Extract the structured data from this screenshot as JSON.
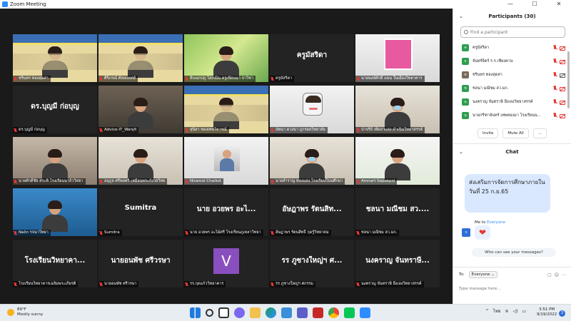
{
  "window": {
    "title": "Zoom Meeting",
    "controls": [
      "—",
      "☐",
      "✕"
    ]
  },
  "tiles": [
    {
      "label": "ชรินทร ทองสุดสา",
      "visual": "banner-person"
    },
    {
      "label": "ศิริภรณ์ ศัลยแพทย์",
      "visual": "banner-person"
    },
    {
      "label": "สิบเอกปภู โสภณิน ครูเขียนนา จาวิชา",
      "visual": "green-person"
    },
    {
      "label": "ครูมัสริดา",
      "display": "ครูมัสริดา"
    },
    {
      "label": "นายพงษ์ศักดิ์ แพน ในเมืองวิทยาคาร",
      "visual": "pink-frame"
    },
    {
      "label": "ดร.บุญมี ก่อบุญ",
      "display": "ดร.บุญมี ก่อบุญ"
    },
    {
      "label": "Advice-IT_Wanjit",
      "visual": "office-person"
    },
    {
      "label": "สุนิสา ทองเทพวิจารณ์",
      "visual": "banner-person"
    },
    {
      "label": "ปพนา ดวงนา ภูกรผลวิทยาลัย",
      "visual": "cartoon"
    },
    {
      "label": "ปาจรีย์ เพียลาแสง ดำเนินวิทยาสรรค์",
      "visual": "mask-person"
    },
    {
      "label": "นายศักดิ์ชัย สระทิ โรงเรียนนาถ้ววิทยา",
      "visual": "room-person"
    },
    {
      "label": "อนุกูล ศรีพลตรี เหมือนพระกังวลวิทย",
      "visual": "wall-person"
    },
    {
      "label": "Niramol Chaikot",
      "visual": "photo"
    },
    {
      "label": "นายสำราญ ทองแสง โรงเรียนโนนศึกษา",
      "visual": "mask-person"
    },
    {
      "label": "Amnart Sopakpol",
      "visual": "green-person2"
    },
    {
      "label": "Nalin รจนาวิทยา",
      "visual": "blue-person"
    },
    {
      "label": "Sumitra",
      "display": "Sumitra"
    },
    {
      "label": "นาย อวยพร อะไม้ศรี โรงเรียนภูเหลาวิทยา",
      "display": "นาย อวยพร อะไ..."
    },
    {
      "label": "อัษฎาพร รัตนสิทธิ์ กุดรู้วิทยาคม",
      "display": "อัษฎาพร รัตนสิท..."
    },
    {
      "label": "ชลนา มณีชม สว.มก.",
      "display": "ชลนา มณีชม สว...."
    },
    {
      "label": "โรงเรียนวิทยาคารเฉลิมพระเกียรติ",
      "display": "โรงเรียนวิทยาคา..."
    },
    {
      "label": "นายอนพัช ศรีวรษา",
      "display": "นายอนพัช ศรีวรษา"
    },
    {
      "label": "รร.กุดแก้ววิทยาคาร",
      "visual": "v-avatar",
      "avatar_letter": "V"
    },
    {
      "label": "รร ภูซางใหญ่ฯ ศกรรม",
      "display": "รร ภูซางใหญ่ฯ ศ..."
    },
    {
      "label": "นงคราญ จันทราษี อึ่งเลงวิทยาสรรค์",
      "display": "นงคราญ จันทราษี..."
    }
  ],
  "participants_panel": {
    "title": "Participants (30)",
    "search_placeholder": "Find a participant",
    "items": [
      {
        "initial": "ค",
        "name": "ครูมัสริดา",
        "color": "#2e9e4e",
        "video_off": true
      },
      {
        "initial": "จ",
        "name": "จันทร์จิตร์ ร.ร.เชียงคาน",
        "color": "#2e9e4e",
        "video_off": true
      },
      {
        "initial": "ช",
        "name": "ชรินทร ทองสุดสา",
        "color": "#7a6a58",
        "video_off": false
      },
      {
        "initial": "ช",
        "name": "ชลนา มณีชม สว.มก.",
        "color": "#2e9e4e",
        "video_off": true
      },
      {
        "initial": "น",
        "name": "นงคราญ จันทราษี อึ่งเลงวิทยาสรรค์",
        "color": "#2e9e4e",
        "video_off": true
      },
      {
        "initial": "น",
        "name": "นายกรีฑาจันทร์ เทพทองมา โรงเรียนน...",
        "color": "#2e9e4e",
        "video_off": true
      }
    ],
    "invite_label": "Invite",
    "mute_all_label": "Mute All",
    "more_label": "..."
  },
  "chat_panel": {
    "title": "Chat",
    "message_text": "ส่งเสริมการจัดการศึกษาภายในวันที่ 25 ก.ย.65",
    "me_to": "Me to",
    "everyone": "Everyone",
    "reaction": "❤",
    "who_can_see": "Who can see your messages?",
    "to_label": "To:",
    "recipient": "Everyone ⌄",
    "input_placeholder": "Type message here..."
  },
  "taskbar": {
    "temperature": "89°F",
    "weather": "Mostly sunny",
    "language": "ไทย",
    "time": "3:51 PM",
    "date": "9/19/2022",
    "notification_count": "3"
  }
}
